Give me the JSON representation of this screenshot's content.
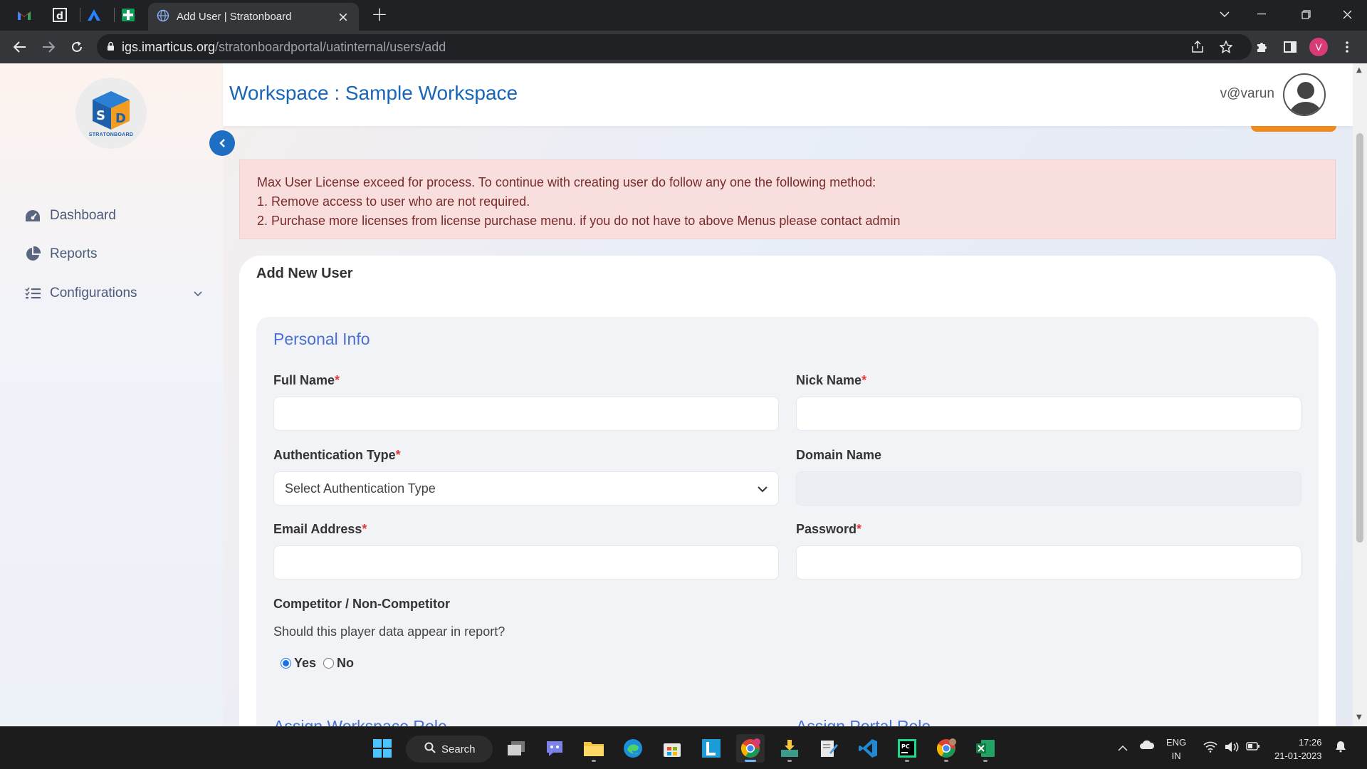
{
  "browser": {
    "tab_title": "Add User | Stratonboard",
    "url_host": "igs.imarticus.org",
    "url_path": "/stratonboardportal/uatinternal/users/add",
    "profile_initial": "V",
    "pinned_tabs": [
      "gmail-icon",
      "dash-icon",
      "atlassian-icon",
      "sheets-icon"
    ]
  },
  "sidebar": {
    "logo_text": "STRATONBOARD",
    "items": [
      {
        "label": "Dashboard",
        "icon": "dashboard-icon"
      },
      {
        "label": "Reports",
        "icon": "pie-chart-icon"
      },
      {
        "label": "Configurations",
        "icon": "list-icon"
      }
    ]
  },
  "header": {
    "workspace_title": "Workspace : Sample Workspace",
    "user_name": "v@varun"
  },
  "alert": {
    "line1": "Max User License exceed for process. To continue with creating user do follow any one the following method:",
    "line2": "1. Remove access to user who are not required.",
    "line3": "2. Purchase more licenses from license purchase menu. if you do not have to above Menus please contact admin"
  },
  "form": {
    "title": "Add New User",
    "section_title": "Personal Info",
    "full_name_label": "Full Name",
    "nick_name_label": "Nick Name",
    "auth_type_label": "Authentication Type",
    "auth_type_value": "Select Authentication Type",
    "domain_name_label": "Domain Name",
    "email_label": "Email Address",
    "password_label": "Password",
    "required_mark": "*",
    "competitor_label": "Competitor / Non-Competitor",
    "competitor_question": "Should this player data appear in report?",
    "radio_yes": "Yes",
    "radio_no": "No",
    "selected_radio": "Yes",
    "next_section_left": "Assign Workspace Role",
    "next_section_right": "Assign Portal Role"
  },
  "taskbar": {
    "search_label": "Search",
    "lang_line1": "ENG",
    "lang_line2": "IN",
    "time": "17:26",
    "date": "21-01-2023"
  },
  "colors": {
    "accent": "#1766b8",
    "section_title": "#4a6fd1",
    "alert_bg": "#f9dede",
    "required": "#e53935"
  }
}
